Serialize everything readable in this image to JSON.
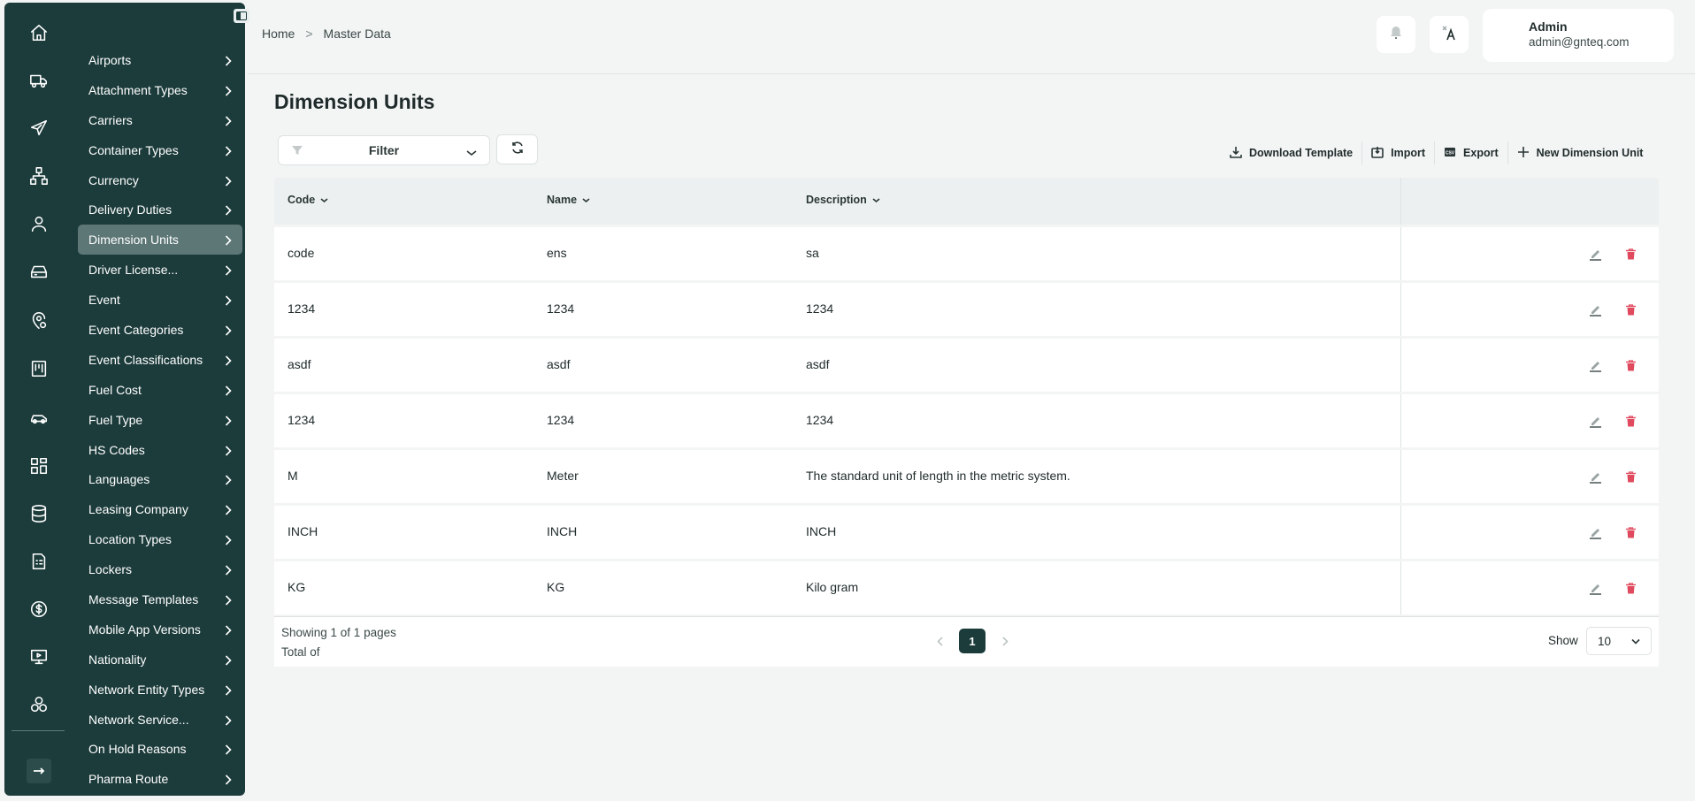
{
  "sidebar": {
    "rail_icons": [
      "home-icon",
      "truck-icon",
      "plane-icon",
      "network-icon",
      "user-icon",
      "drive-icon",
      "location-icon",
      "board-icon",
      "car-icon",
      "grid-icon",
      "database-icon",
      "document-icon",
      "dollar-icon",
      "presentation-icon",
      "shapes-icon"
    ],
    "items": [
      {
        "label": "Airports"
      },
      {
        "label": "Attachment Types"
      },
      {
        "label": "Carriers"
      },
      {
        "label": "Container Types"
      },
      {
        "label": "Currency"
      },
      {
        "label": "Delivery Duties"
      },
      {
        "label": "Dimension Units",
        "active": true
      },
      {
        "label": "Driver License..."
      },
      {
        "label": "Event"
      },
      {
        "label": "Event Categories"
      },
      {
        "label": "Event Classifications"
      },
      {
        "label": "Fuel Cost"
      },
      {
        "label": "Fuel Type"
      },
      {
        "label": "HS Codes"
      },
      {
        "label": "Languages"
      },
      {
        "label": "Leasing Company"
      },
      {
        "label": "Location Types"
      },
      {
        "label": "Lockers"
      },
      {
        "label": "Message Templates"
      },
      {
        "label": "Mobile App Versions"
      },
      {
        "label": "Nationality"
      },
      {
        "label": "Network Entity Types"
      },
      {
        "label": "Network Service..."
      },
      {
        "label": "On Hold Reasons"
      },
      {
        "label": "Pharma Route"
      }
    ]
  },
  "header": {
    "breadcrumb": [
      "Home",
      "Master Data"
    ],
    "breadcrumb_sep": ">",
    "user": {
      "name": "Admin",
      "email": "admin@gnteq.com"
    }
  },
  "main": {
    "title": "Dimension Units",
    "filter_label": "Filter",
    "actions": {
      "download_template": "Download Template",
      "import": "Import",
      "export": "Export",
      "new": "New Dimension Unit"
    },
    "columns": [
      "Code",
      "Name",
      "Description"
    ],
    "rows": [
      {
        "code": "code",
        "name": "ens",
        "description": "sa"
      },
      {
        "code": "1234",
        "name": "1234",
        "description": "1234"
      },
      {
        "code": "asdf",
        "name": "asdf",
        "description": "asdf"
      },
      {
        "code": "1234",
        "name": "1234",
        "description": "1234"
      },
      {
        "code": "M",
        "name": "Meter",
        "description": "The standard unit of length in the metric system."
      },
      {
        "code": "INCH",
        "name": "INCH",
        "description": "INCH"
      },
      {
        "code": "KG",
        "name": "KG",
        "description": "Kilo gram"
      }
    ],
    "footer": {
      "showing": "Showing 1 of 1 pages",
      "total": "Total of",
      "current_page": "1",
      "show_label": "Show",
      "page_size": "10"
    }
  },
  "colors": {
    "sidebar_bg": "#1c3b3b",
    "active_item": "#5d7676",
    "delete_red": "#e04a5e"
  }
}
